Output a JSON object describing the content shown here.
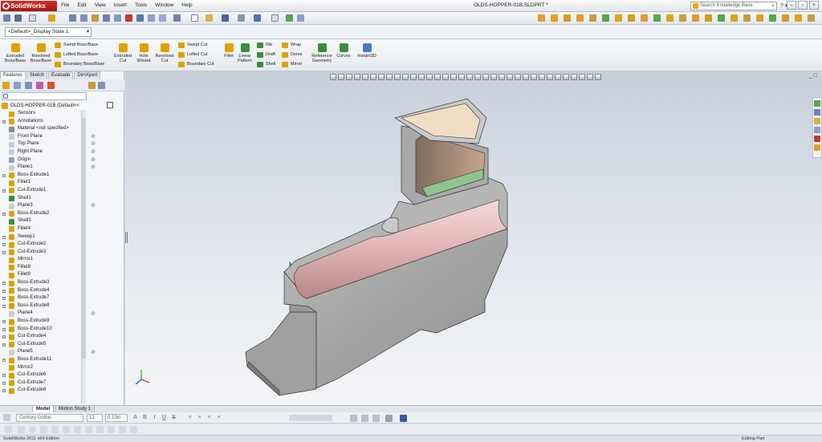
{
  "app": {
    "brand": "SolidWorks",
    "document_title": "OLDS-HOPPER-01B.SLDPRT *"
  },
  "menu": [
    "File",
    "Edit",
    "View",
    "Insert",
    "Tools",
    "Window",
    "Help"
  ],
  "search": {
    "placeholder": "Search Knowledge Base"
  },
  "config": {
    "selected": "<Default>_Display State 1"
  },
  "commands": {
    "large": [
      {
        "label": "Extruded Boss/Base",
        "color": "#d9a300"
      },
      {
        "label": "Revolved Boss/Base",
        "color": "#d9a300"
      },
      {
        "label": "Extruded Cut",
        "color": "#d9a300"
      },
      {
        "label": "Hole Wizard",
        "color": "#d9a300"
      },
      {
        "label": "Revolved Cut",
        "color": "#d9a300"
      },
      {
        "label": "Fillet",
        "color": "#d9a300"
      },
      {
        "label": "Linear Pattern",
        "color": "#3a8d3a"
      },
      {
        "label": "Reference Geometry",
        "color": "#3a8d3a"
      },
      {
        "label": "Curves",
        "color": "#3a8d3a"
      },
      {
        "label": "Instant3D",
        "color": "#4a78c4"
      }
    ],
    "small": [
      {
        "label": "Swept Boss/Base",
        "color": "#d9a300"
      },
      {
        "label": "Lofted Boss/Base",
        "color": "#d9a300"
      },
      {
        "label": "Boundary Boss/Base",
        "color": "#d9a300"
      },
      {
        "label": "Swept Cut",
        "color": "#d9a300"
      },
      {
        "label": "Lofted Cut",
        "color": "#d9a300"
      },
      {
        "label": "Boundary Cut",
        "color": "#d9a300"
      },
      {
        "label": "Rib",
        "color": "#3a8d3a"
      },
      {
        "label": "Draft",
        "color": "#3a8d3a"
      },
      {
        "label": "Shell",
        "color": "#3a8d3a"
      },
      {
        "label": "Wrap",
        "color": "#d9a300"
      },
      {
        "label": "Dome",
        "color": "#d9a300"
      },
      {
        "label": "Mirror",
        "color": "#d9a300"
      }
    ]
  },
  "panel_tabs": [
    "Features",
    "Sketch",
    "Evaluate",
    "DimXpert"
  ],
  "tree": {
    "root": "OLDS-HOPPER-01B  (Default<<",
    "items": [
      {
        "label": "Sensors",
        "icon": "sensors-icon",
        "expand": false,
        "suppress": false
      },
      {
        "label": "Annotations",
        "icon": "annotations-icon",
        "expand": true,
        "suppress": false
      },
      {
        "label": "Material <not specified>",
        "icon": "material-icon",
        "expand": false,
        "suppress": false
      },
      {
        "label": "Front Plane",
        "icon": "plane-icon",
        "expand": false,
        "suppress": true
      },
      {
        "label": "Top Plane",
        "icon": "plane-icon",
        "expand": false,
        "suppress": true
      },
      {
        "label": "Right Plane",
        "icon": "plane-icon",
        "expand": false,
        "suppress": true
      },
      {
        "label": "Origin",
        "icon": "origin-icon",
        "expand": false,
        "suppress": true
      },
      {
        "label": "Plane1",
        "icon": "plane-icon",
        "expand": false,
        "suppress": true
      },
      {
        "label": "Boss-Extrude1",
        "icon": "boss-extrude-icon",
        "expand": true,
        "suppress": false
      },
      {
        "label": "Fillet1",
        "icon": "fillet-icon",
        "expand": false,
        "suppress": false
      },
      {
        "label": "Cut-Extrude1",
        "icon": "cut-extrude-icon",
        "expand": true,
        "suppress": false
      },
      {
        "label": "Shell1",
        "icon": "shell-icon",
        "expand": false,
        "suppress": false
      },
      {
        "label": "Plane3",
        "icon": "plane-icon",
        "expand": false,
        "suppress": true
      },
      {
        "label": "Boss-Extrude2",
        "icon": "boss-extrude-icon",
        "expand": true,
        "suppress": false
      },
      {
        "label": "Shell3",
        "icon": "shell-icon",
        "expand": false,
        "suppress": false
      },
      {
        "label": "Fillet4",
        "icon": "fillet-icon",
        "expand": false,
        "suppress": false
      },
      {
        "label": "Sweep1",
        "icon": "sweep-icon",
        "expand": true,
        "suppress": false
      },
      {
        "label": "Cut-Extrude2",
        "icon": "cut-extrude-icon",
        "expand": true,
        "suppress": false
      },
      {
        "label": "Cut-Extrude3",
        "icon": "cut-extrude-icon",
        "expand": true,
        "suppress": false
      },
      {
        "label": "Mirror1",
        "icon": "mirror-icon",
        "expand": false,
        "suppress": false
      },
      {
        "label": "Fillet8",
        "icon": "fillet-icon",
        "expand": false,
        "suppress": false
      },
      {
        "label": "Fillet9",
        "icon": "fillet-icon",
        "expand": false,
        "suppress": false
      },
      {
        "label": "Boss-Extrude3",
        "icon": "boss-extrude-icon",
        "expand": true,
        "suppress": false
      },
      {
        "label": "Boss-Extrude4",
        "icon": "boss-extrude-icon",
        "expand": true,
        "suppress": false
      },
      {
        "label": "Boss-Extrude7",
        "icon": "boss-extrude-icon",
        "expand": true,
        "suppress": false
      },
      {
        "label": "Boss-Extrude8",
        "icon": "boss-extrude-icon",
        "expand": true,
        "suppress": false
      },
      {
        "label": "Plane4",
        "icon": "plane-icon",
        "expand": false,
        "suppress": true
      },
      {
        "label": "Boss-Extrude9",
        "icon": "boss-extrude-icon",
        "expand": true,
        "suppress": false
      },
      {
        "label": "Boss-Extrude10",
        "icon": "boss-extrude-icon",
        "expand": true,
        "suppress": false
      },
      {
        "label": "Cut-Extrude4",
        "icon": "cut-extrude-icon",
        "expand": true,
        "suppress": false
      },
      {
        "label": "Cut-Extrude5",
        "icon": "cut-extrude-icon",
        "expand": true,
        "suppress": false
      },
      {
        "label": "Plane5",
        "icon": "plane-icon",
        "expand": false,
        "suppress": true
      },
      {
        "label": "Boss-Extrude11",
        "icon": "boss-extrude-icon",
        "expand": true,
        "suppress": false
      },
      {
        "label": "Mirror2",
        "icon": "mirror-icon",
        "expand": false,
        "suppress": false
      },
      {
        "label": "Cut-Extrude6",
        "icon": "cut-extrude-icon",
        "expand": true,
        "suppress": false
      },
      {
        "label": "Cut-Extrude7",
        "icon": "cut-extrude-icon",
        "expand": true,
        "suppress": false
      },
      {
        "label": "Cut-Extrude8",
        "icon": "cut-extrude-icon",
        "expand": true,
        "suppress": false
      }
    ]
  },
  "bottom_tabs": [
    "Model",
    "Motion Study 1"
  ],
  "format": {
    "font": "Century Gothic",
    "size": "12",
    "height": "0.13in"
  },
  "status": {
    "left": "SolidWorks 2011 x64 Edition",
    "right": "Editing Part"
  },
  "colors": {
    "part_gray": "#a5a5a5",
    "bore": "#d5a8a8",
    "hopper_inner": "#c7a48a",
    "green_face": "#8fc48f",
    "accent": "#c31d16"
  }
}
